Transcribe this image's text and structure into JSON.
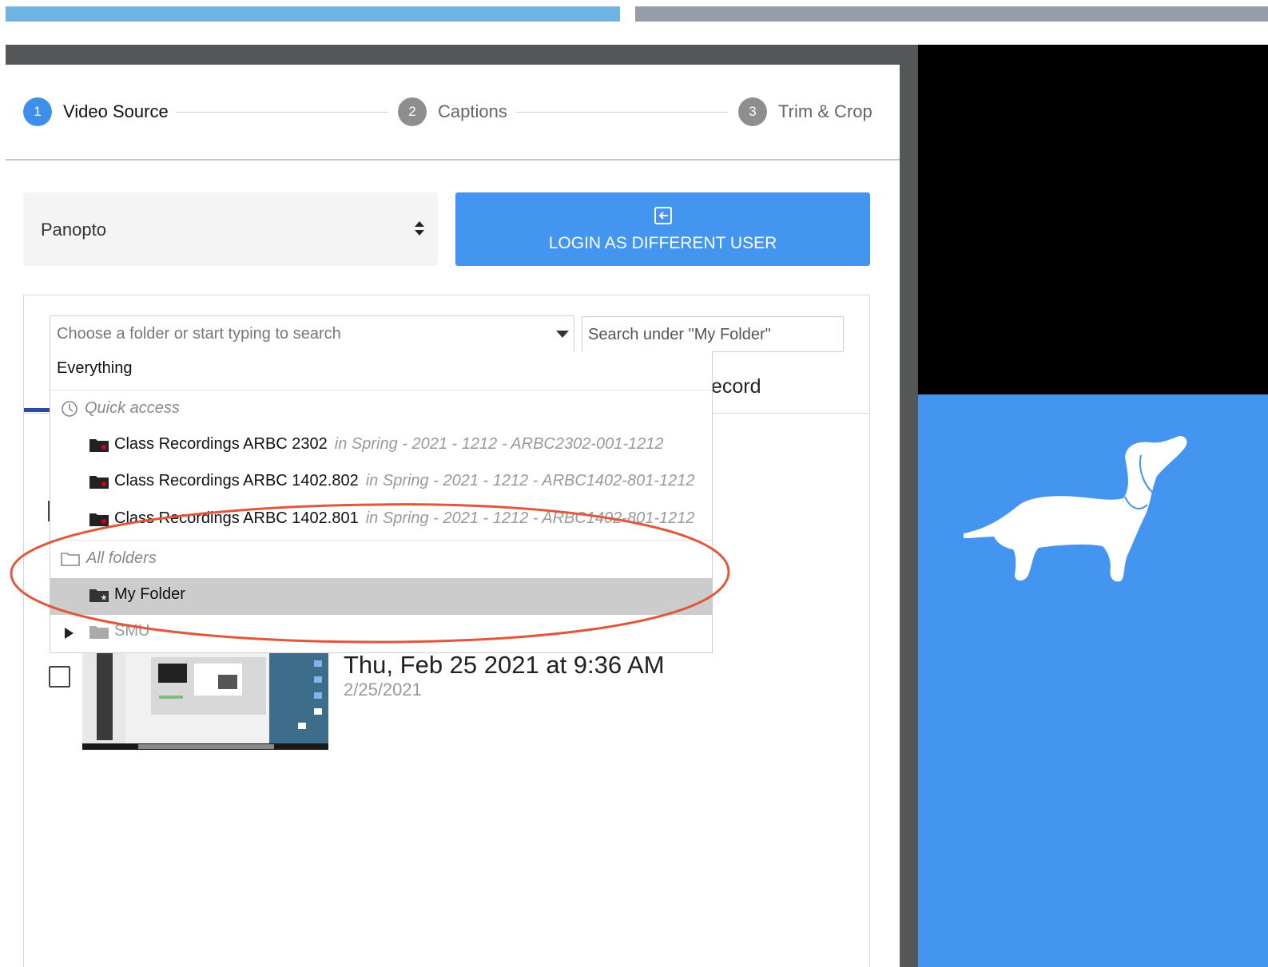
{
  "stepper": {
    "steps": [
      {
        "num": "1",
        "label": "Video Source"
      },
      {
        "num": "2",
        "label": "Captions"
      },
      {
        "num": "3",
        "label": "Trim & Crop"
      }
    ]
  },
  "source": {
    "selected": "Panopto",
    "login_label": "LOGIN AS DIFFERENT USER"
  },
  "browser": {
    "folder_placeholder": "Choose a folder or start typing to search",
    "search_placeholder": "Search under \"My Folder\"",
    "tab_partial_label": "ecord",
    "dropdown": {
      "everything": "Everything",
      "quick_access_label": "Quick access",
      "quick_items": [
        {
          "name": "Class Recordings ARBC 2302",
          "path": "in Spring - 2021 - 1212 - ARBC2302-001-1212"
        },
        {
          "name": "Class Recordings ARBC 1402.802",
          "path": "in Spring - 2021 - 1212 - ARBC1402-801-1212"
        },
        {
          "name": "Class Recordings ARBC 1402.801",
          "path": "in Spring - 2021 - 1212 - ARBC1402-801-1212"
        }
      ],
      "all_folders_label": "All folders",
      "my_folder": "My Folder",
      "smu": "SMU"
    }
  },
  "recording": {
    "title": "Thu, Feb 25 2021 at 9:36 AM",
    "date": "2/25/2021"
  },
  "colors": {
    "accent_blue": "#4495f0",
    "annotation_red": "#e0573a",
    "recording_folder_red": "#d0021b"
  }
}
